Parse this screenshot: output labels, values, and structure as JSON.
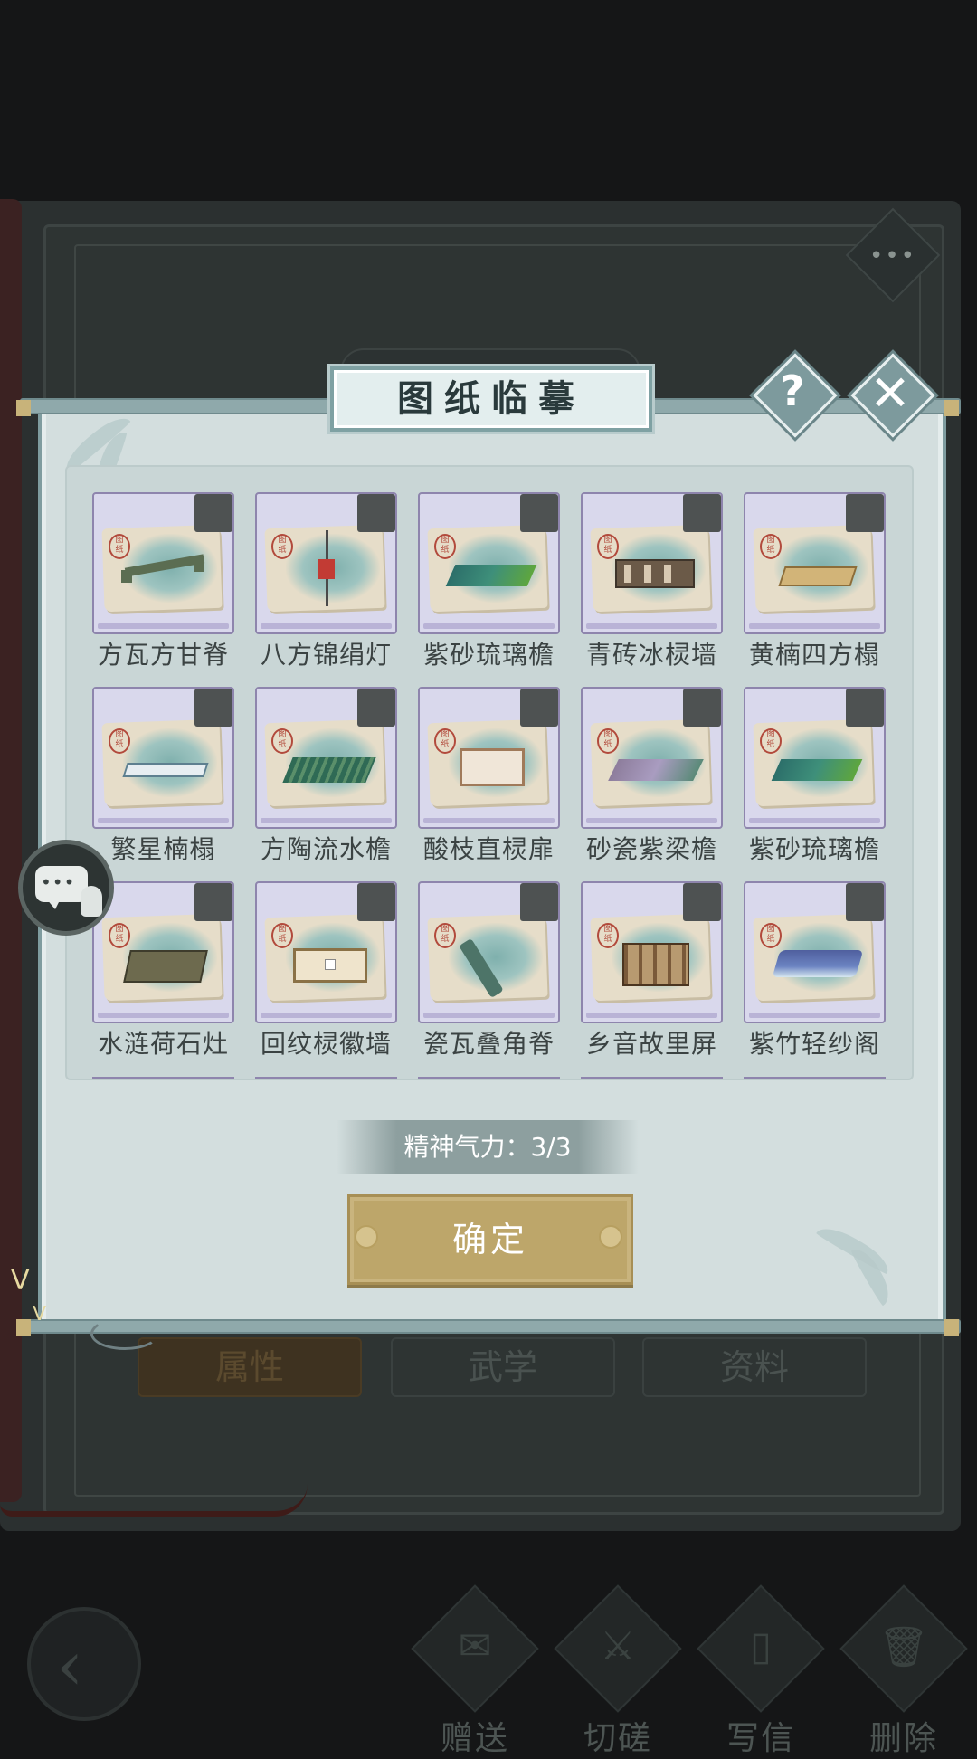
{
  "background": {
    "tabs": [
      "属性",
      "武学",
      "资料"
    ],
    "actions": [
      {
        "label": "赠送",
        "icon": "scroll-icon"
      },
      {
        "label": "切磋",
        "icon": "sword-icon"
      },
      {
        "label": "写信",
        "icon": "letter-icon"
      },
      {
        "label": "删除",
        "icon": "trash-icon"
      }
    ],
    "more_label": "•••"
  },
  "dialog": {
    "title": "图纸临摹",
    "help_label": "?",
    "close_label": "✕"
  },
  "blueprints": [
    {
      "name": "方瓦方甘脊",
      "selected": false
    },
    {
      "name": "八方锦绢灯",
      "selected": false
    },
    {
      "name": "紫砂琉璃檐",
      "selected": false
    },
    {
      "name": "青砖冰棂墙",
      "selected": false
    },
    {
      "name": "黄楠四方榻",
      "selected": false
    },
    {
      "name": "繁星楠榻",
      "selected": false
    },
    {
      "name": "方陶流水檐",
      "selected": false
    },
    {
      "name": "酸枝直棂扉",
      "selected": false
    },
    {
      "name": "砂瓷紫梁檐",
      "selected": false
    },
    {
      "name": "紫砂琉璃檐",
      "selected": false
    },
    {
      "name": "水涟荷石灶",
      "selected": false
    },
    {
      "name": "回纹棂徽墙",
      "selected": false
    },
    {
      "name": "瓷瓦叠角脊",
      "selected": false
    },
    {
      "name": "乡音故里屏",
      "selected": false
    },
    {
      "name": "紫竹轻纱阁",
      "selected": false
    }
  ],
  "stamina": {
    "text": "精神气力：3/3",
    "current": 3,
    "max": 3
  },
  "confirm_label": "确定",
  "colors": {
    "modal_bg": "#d3dede",
    "card_bg": "#d9d8ec",
    "confirm_gold": "#bda66a",
    "checkbox": "#4e5252"
  }
}
